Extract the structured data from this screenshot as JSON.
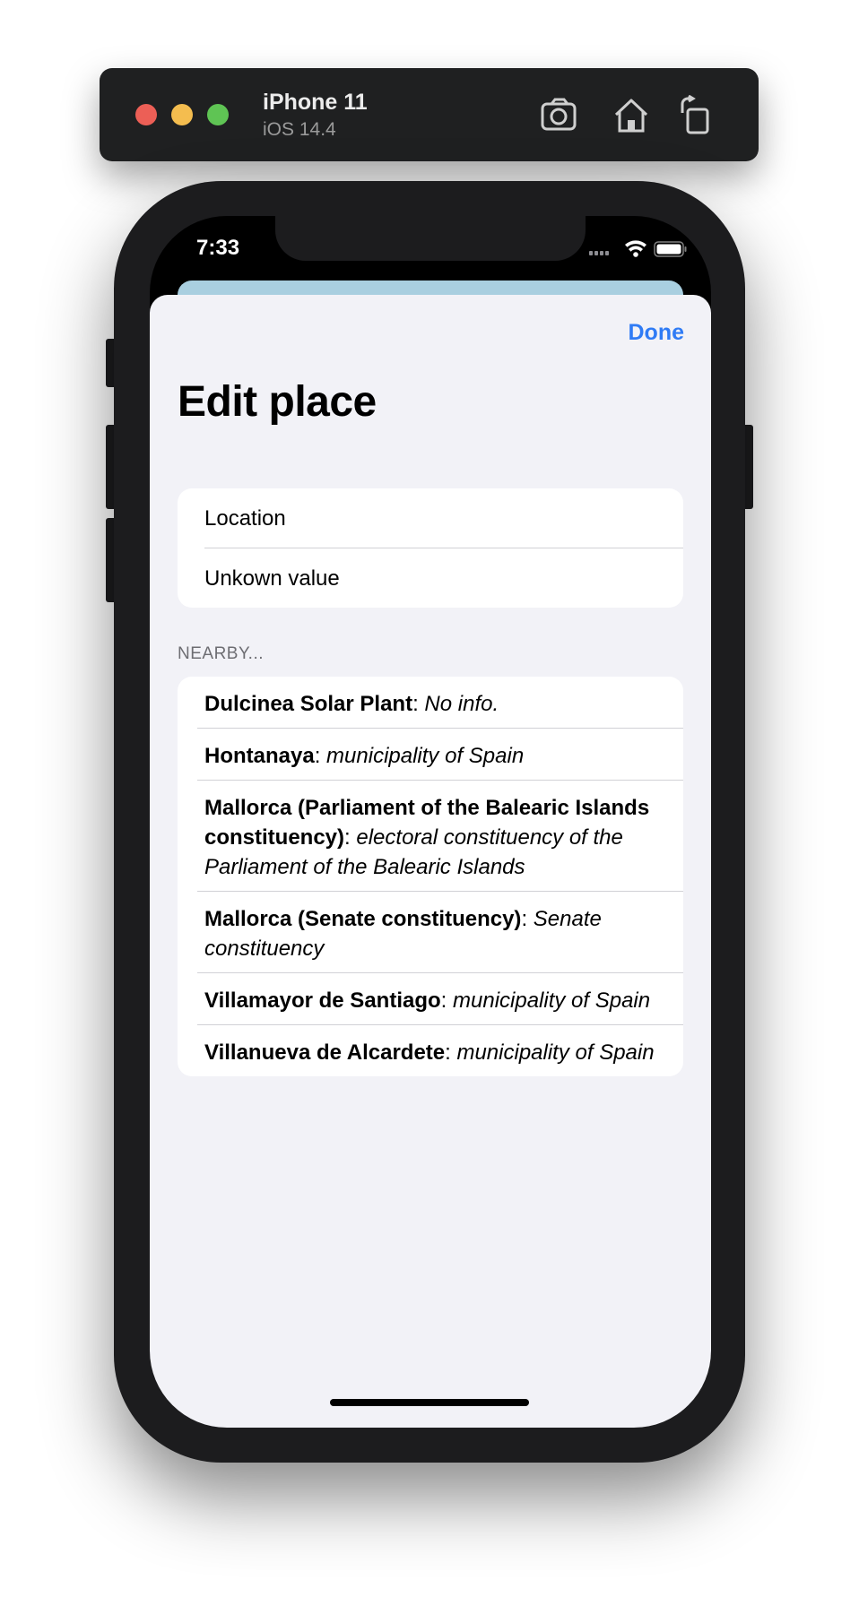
{
  "simulator": {
    "device_name": "iPhone 11",
    "os_version": "iOS 14.4",
    "icons": [
      "screenshot-icon",
      "home-icon",
      "rotate-icon"
    ]
  },
  "status_bar": {
    "time": "7:33"
  },
  "sheet": {
    "done_label": "Done",
    "title": "Edit place",
    "location_group": {
      "header_row": "Location",
      "value_row": "Unkown value"
    },
    "nearby_header": "NEARBY...",
    "nearby": [
      {
        "name": "Dulcinea Solar Plant",
        "sep": ": ",
        "desc": "No info."
      },
      {
        "name": "Hontanaya",
        "sep": ": ",
        "desc": "municipality of Spain"
      },
      {
        "name": "Mallorca (Parliament of the Balearic Islands constituency)",
        "sep": ": ",
        "desc": "electoral constituency of the Parliament of the Balearic Islands"
      },
      {
        "name": "Mallorca (Senate constituency)",
        "sep": ": ",
        "desc": "Senate constituency"
      },
      {
        "name": "Villamayor de Santiago",
        "sep": ": ",
        "desc": "municipality of Spain"
      },
      {
        "name": "Villanueva de Alcardete",
        "sep": ": ",
        "desc": "municipality of Spain"
      }
    ]
  },
  "colors": {
    "accent": "#2f7bf5",
    "sheet_background": "#f2f2f7",
    "group_background": "#ffffff"
  }
}
